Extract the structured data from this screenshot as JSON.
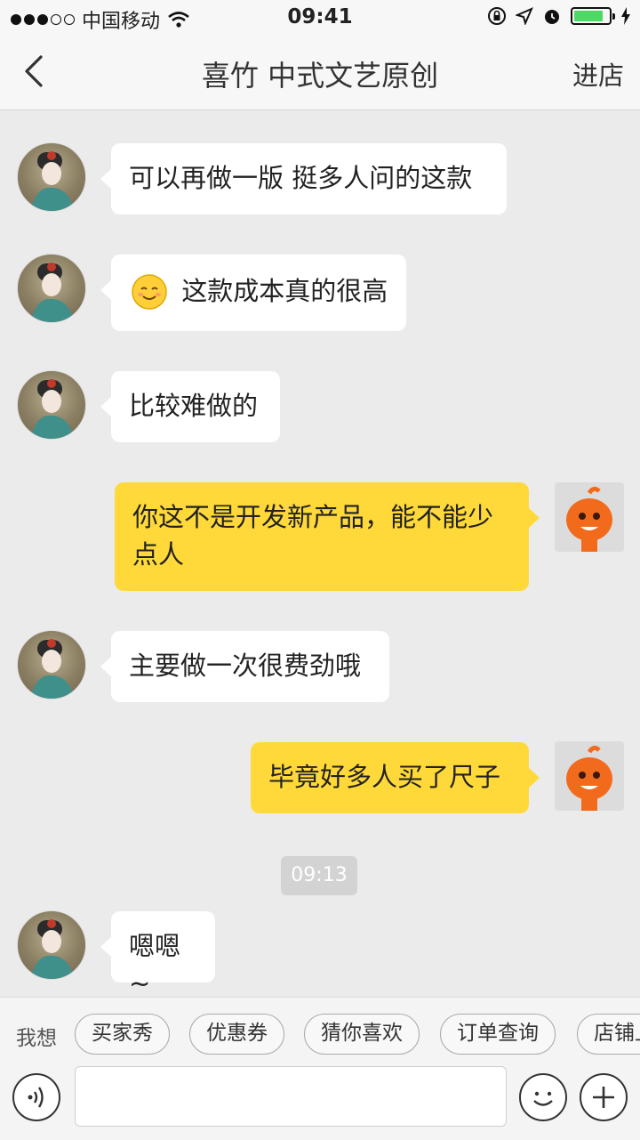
{
  "status_bar": {
    "carrier": "中国移动",
    "time": "09:41",
    "battery_level": 0.85
  },
  "nav": {
    "title": "喜竹 中式文艺原创",
    "enter_shop": "进店"
  },
  "messages": [
    {
      "side": "in",
      "text": "可以再做一版 挺多人问的这款"
    },
    {
      "side": "in",
      "emoji": "smiling-face-emoji",
      "text": "这款成本真的很高"
    },
    {
      "side": "in",
      "text": "比较难做的"
    },
    {
      "side": "out",
      "text": "你这不是开发新产品，能不能少点人"
    },
    {
      "side": "in",
      "text": "主要做一次很费劲哦"
    },
    {
      "side": "out",
      "text": "毕竟好多人买了尺子"
    },
    {
      "side": "in",
      "text": "嗯嗯~"
    }
  ],
  "timestamp": "09:13",
  "quick_bar": {
    "label": "我想",
    "chips": [
      "买家秀",
      "优惠券",
      "猜你喜欢",
      "订单查询",
      "店铺上"
    ]
  },
  "colors": {
    "outgoing_bubble": "#ffd93a",
    "incoming_bubble": "#ffffff",
    "background": "#ebebeb"
  }
}
